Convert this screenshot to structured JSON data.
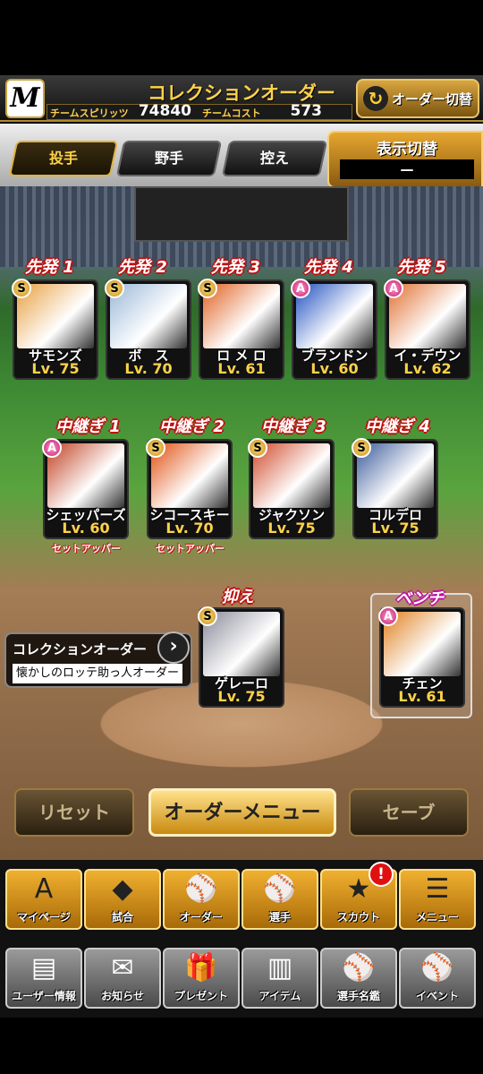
{
  "header": {
    "logo": "M",
    "title": "コレクションオーダー",
    "spirits_label": "チームスピリッツ",
    "spirits_value": "74840",
    "cost_label": "チームコスト",
    "cost_value": "573",
    "order_switch": "オーダー切替"
  },
  "tabs": [
    {
      "label": "投手"
    },
    {
      "label": "野手"
    },
    {
      "label": "控え"
    }
  ],
  "display_toggle": {
    "label": "表示切替",
    "value": "—"
  },
  "starters": [
    {
      "pos": "先発 1",
      "rank": "S",
      "name": "サモンズ",
      "lv": "Lv. 75",
      "color": "#e8a040"
    },
    {
      "pos": "先発 2",
      "rank": "S",
      "name": "ボ　ス",
      "lv": "Lv. 70",
      "color": "#9ab8d8"
    },
    {
      "pos": "先発 3",
      "rank": "S",
      "name": "ロ メ ロ",
      "lv": "Lv. 61",
      "color": "#e06020"
    },
    {
      "pos": "先発 4",
      "rank": "A",
      "name": "ブランドン",
      "lv": "Lv. 60",
      "color": "#2050c0"
    },
    {
      "pos": "先発 5",
      "rank": "A",
      "name": "イ・デウン",
      "lv": "Lv. 62",
      "color": "#e07030"
    }
  ],
  "relievers": [
    {
      "pos": "中継ぎ 1",
      "rank": "A",
      "name": "シェッパーズ",
      "lv": "Lv. 60",
      "tag": "セットアッパー",
      "color": "#c04020"
    },
    {
      "pos": "中継ぎ 2",
      "rank": "S",
      "name": "シコースキー",
      "lv": "Lv. 70",
      "tag": "セットアッパー",
      "color": "#e05010"
    },
    {
      "pos": "中継ぎ 3",
      "rank": "S",
      "name": "ジャクソン",
      "lv": "Lv. 75",
      "tag": "",
      "color": "#d04a2a"
    },
    {
      "pos": "中継ぎ 4",
      "rank": "S",
      "name": "コルデロ",
      "lv": "Lv. 75",
      "tag": "",
      "color": "#3a5a9a"
    }
  ],
  "closer": {
    "pos": "抑え",
    "rank": "S",
    "name": "ゲレーロ",
    "lv": "Lv. 75",
    "color": "#8a8a9a"
  },
  "bench": {
    "pos": "ベンチ",
    "rank": "A",
    "name": "チェン",
    "lv": "Lv. 61",
    "color": "#e08020"
  },
  "collection": {
    "title": "コレクションオーダー",
    "subtitle": "懐かしのロッテ助っ人オーダー"
  },
  "buttons": {
    "reset": "リセット",
    "menu": "オーダーメニュー",
    "save": "セーブ"
  },
  "nav_primary": [
    {
      "label": "マイページ",
      "icon": "A"
    },
    {
      "label": "試合",
      "icon": "◆"
    },
    {
      "label": "オーダー",
      "icon": "⚾"
    },
    {
      "label": "選手",
      "icon": "⚾"
    },
    {
      "label": "スカウト",
      "icon": "★"
    },
    {
      "label": "メニュー",
      "icon": "☰"
    }
  ],
  "nav_secondary": [
    {
      "label": "ユーザー情報",
      "icon": "▤"
    },
    {
      "label": "お知らせ",
      "icon": "✉"
    },
    {
      "label": "プレゼント",
      "icon": "🎁"
    },
    {
      "label": "アイテム",
      "icon": "▥"
    },
    {
      "label": "選手名鑑",
      "icon": "⚾"
    },
    {
      "label": "イベント",
      "icon": "⚾"
    }
  ],
  "scout_badge": "!"
}
